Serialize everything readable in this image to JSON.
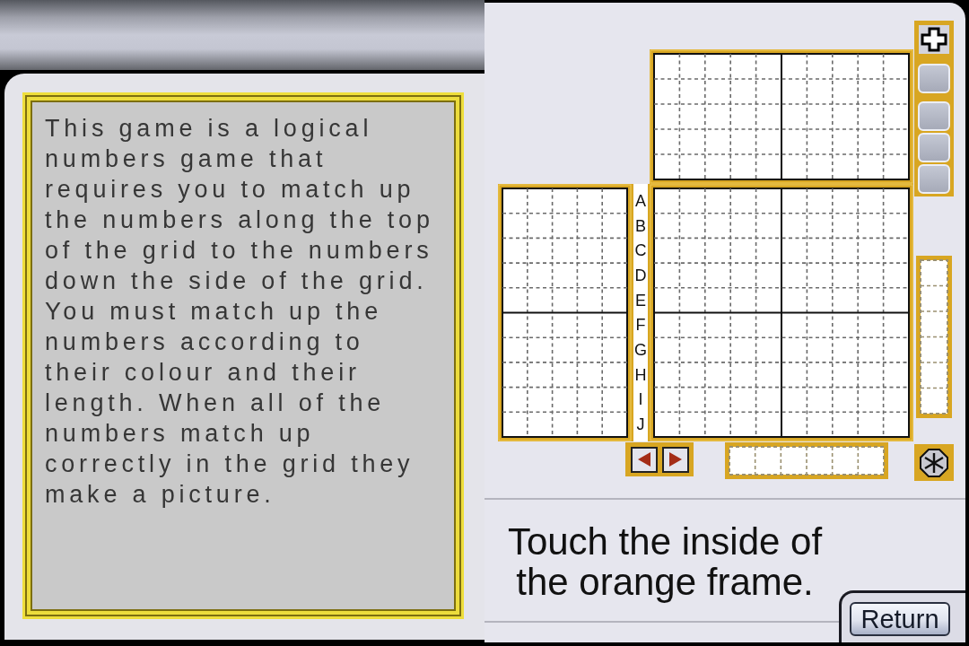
{
  "instructions": {
    "text": "This game is a logical\nnumbers game that\nrequires you to match up\nthe numbers along the top\nof the grid to the numbers\ndown the side of the grid.\nYou must match up the\nnumbers according to\ntheir colour and their\nlength. When all of the\nnumbers match up\ncorrectly in the grid they\nmake a picture."
  },
  "puzzle": {
    "row_labels": [
      "A",
      "B",
      "C",
      "D",
      "E",
      "F",
      "G",
      "H",
      "I",
      "J"
    ]
  },
  "hint": "Touch the inside of the orange frame.",
  "return_button": {
    "label": "Return"
  }
}
